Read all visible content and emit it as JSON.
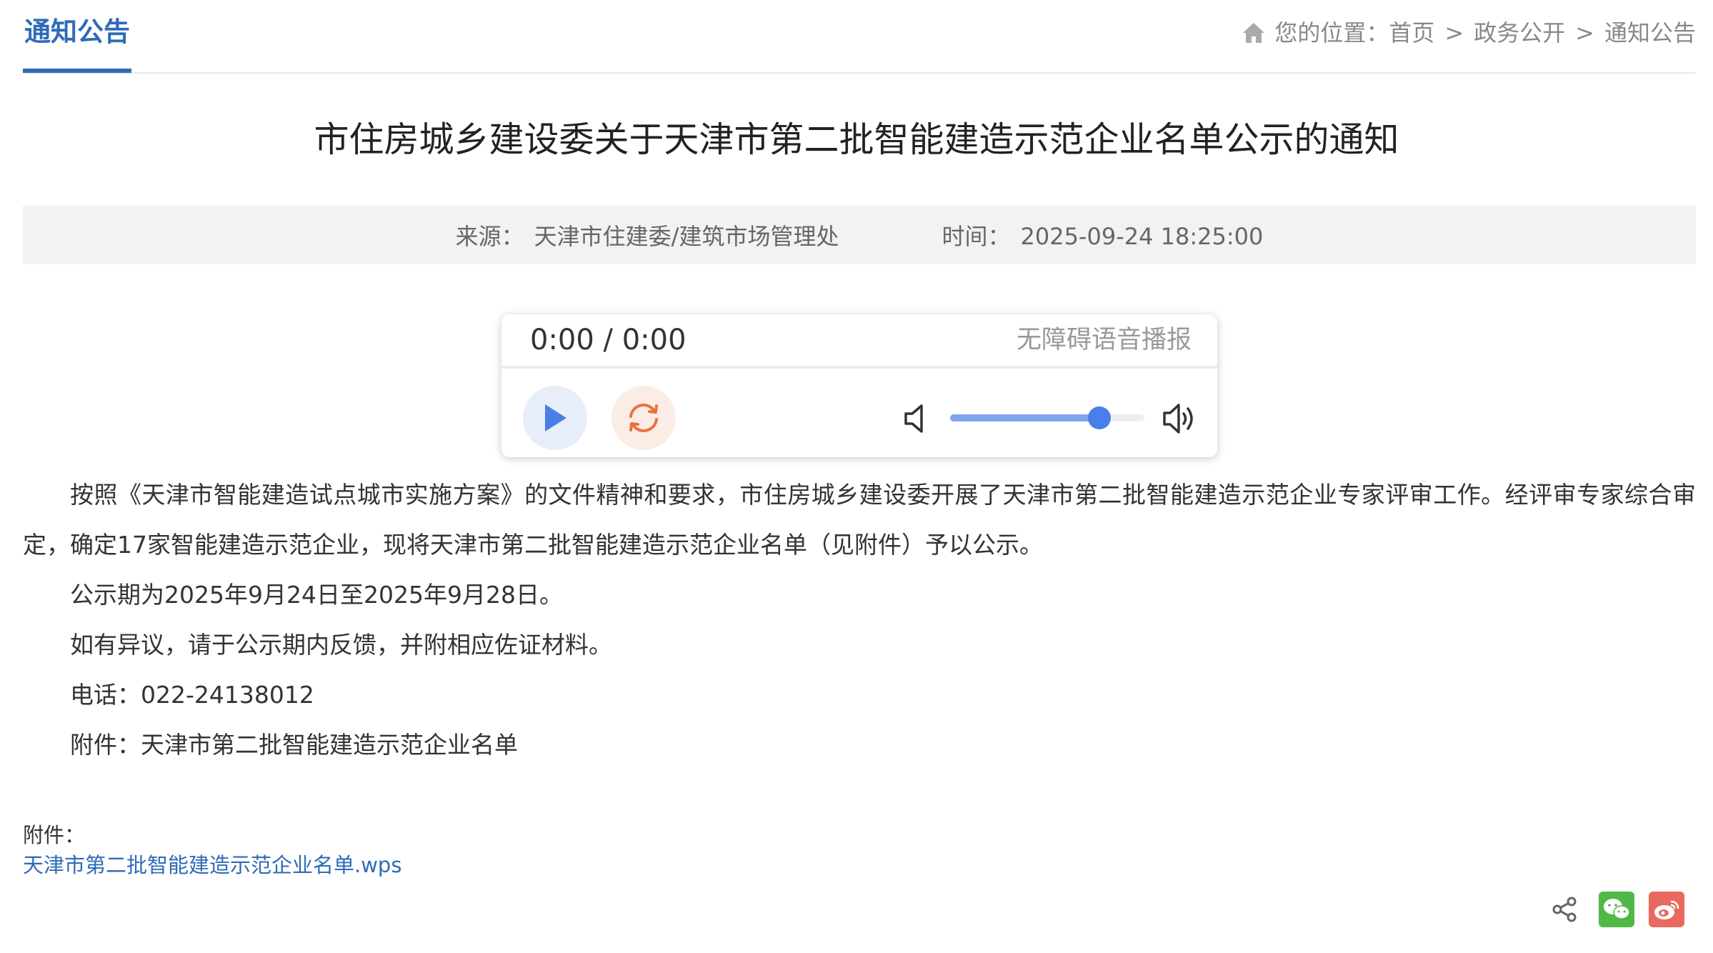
{
  "header": {
    "tab_label": "通知公告",
    "breadcrumb": {
      "prefix": "您的位置：",
      "items": [
        "首页",
        "政务公开",
        "通知公告"
      ],
      "separator": ">"
    }
  },
  "article": {
    "title": "市住房城乡建设委关于天津市第二批智能建造示范企业名单公示的通知",
    "source_label": "来源：",
    "source": "天津市住建委/建筑市场管理处",
    "time_label": "时间：",
    "time": "2025-09-24 18:25:00",
    "paragraphs": [
      "按照《天津市智能建造试点城市实施方案》的文件精神和要求，市住房城乡建设委开展了天津市第二批智能建造示范企业专家评审工作。经评审专家综合审定，确定17家智能建造示范企业，现将天津市第二批智能建造示范企业名单（见附件）予以公示。",
      "公示期为2025年9月24日至2025年9月28日。",
      "如有异议，请于公示期内反馈，并附相应佐证材料。",
      "电话：022-24138012",
      "附件：天津市第二批智能建造示范企业名单"
    ],
    "attachment_label": "附件：",
    "attachment_file": "天津市第二批智能建造示范企业名单.wps"
  },
  "player": {
    "time_display": "0:00 / 0:00",
    "title": "无障碍语音播报",
    "volume_level": 0.77
  },
  "colors": {
    "accent": "#2e6bb8",
    "play": "#4a7ee8",
    "replay": "#e8733d",
    "wechat": "#51b848",
    "weibo": "#e86a5f"
  },
  "share": {
    "icons": [
      "share-icon",
      "wechat-icon",
      "weibo-icon"
    ]
  }
}
